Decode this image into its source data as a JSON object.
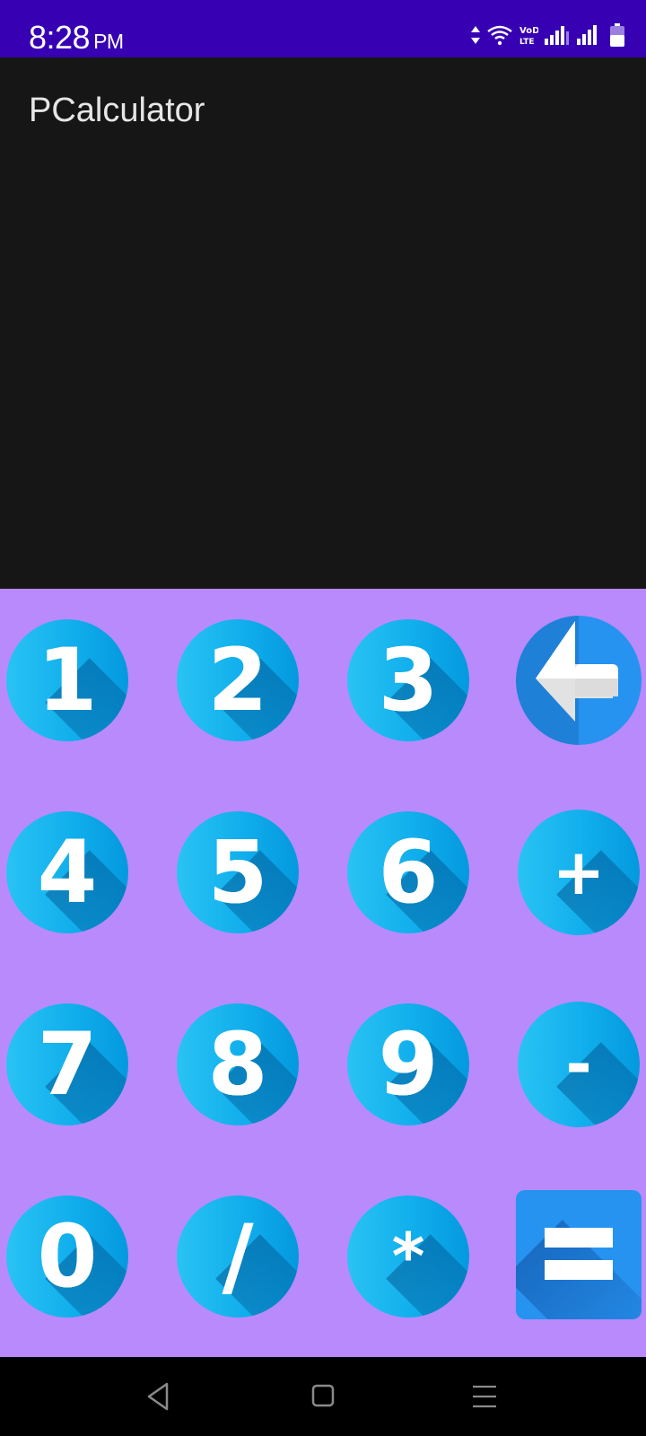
{
  "status_bar": {
    "time": "8:28",
    "ampm": "PM",
    "icons": [
      "data-arrows-icon",
      "wifi-icon",
      "volte-icon",
      "signal-sim1-icon",
      "signal-sim2-icon",
      "battery-icon"
    ],
    "volte_text": "VoD LTE"
  },
  "app": {
    "title": "PCalculator",
    "background": "#161616"
  },
  "keypad": {
    "background": "#b98afc",
    "accent": "#29c3f4",
    "rows": [
      [
        "1",
        "2",
        "3",
        "backspace"
      ],
      [
        "4",
        "5",
        "6",
        "+"
      ],
      [
        "7",
        "8",
        "9",
        "-"
      ],
      [
        "0",
        "/",
        "*",
        "="
      ]
    ],
    "labels": {
      "k1": "1",
      "k2": "2",
      "k3": "3",
      "k4": "4",
      "k5": "5",
      "k6": "6",
      "plus": "+",
      "k7": "7",
      "k8": "8",
      "k9": "9",
      "minus": "-",
      "k0": "0",
      "divide": "/",
      "multiply": "*"
    }
  },
  "nav_bar": {
    "buttons": [
      "back-icon",
      "home-icon",
      "recents-icon"
    ]
  },
  "colors": {
    "status_bar": "#3700b3",
    "equals_key": "#2693f0",
    "backspace_key": "#1f80d8"
  }
}
